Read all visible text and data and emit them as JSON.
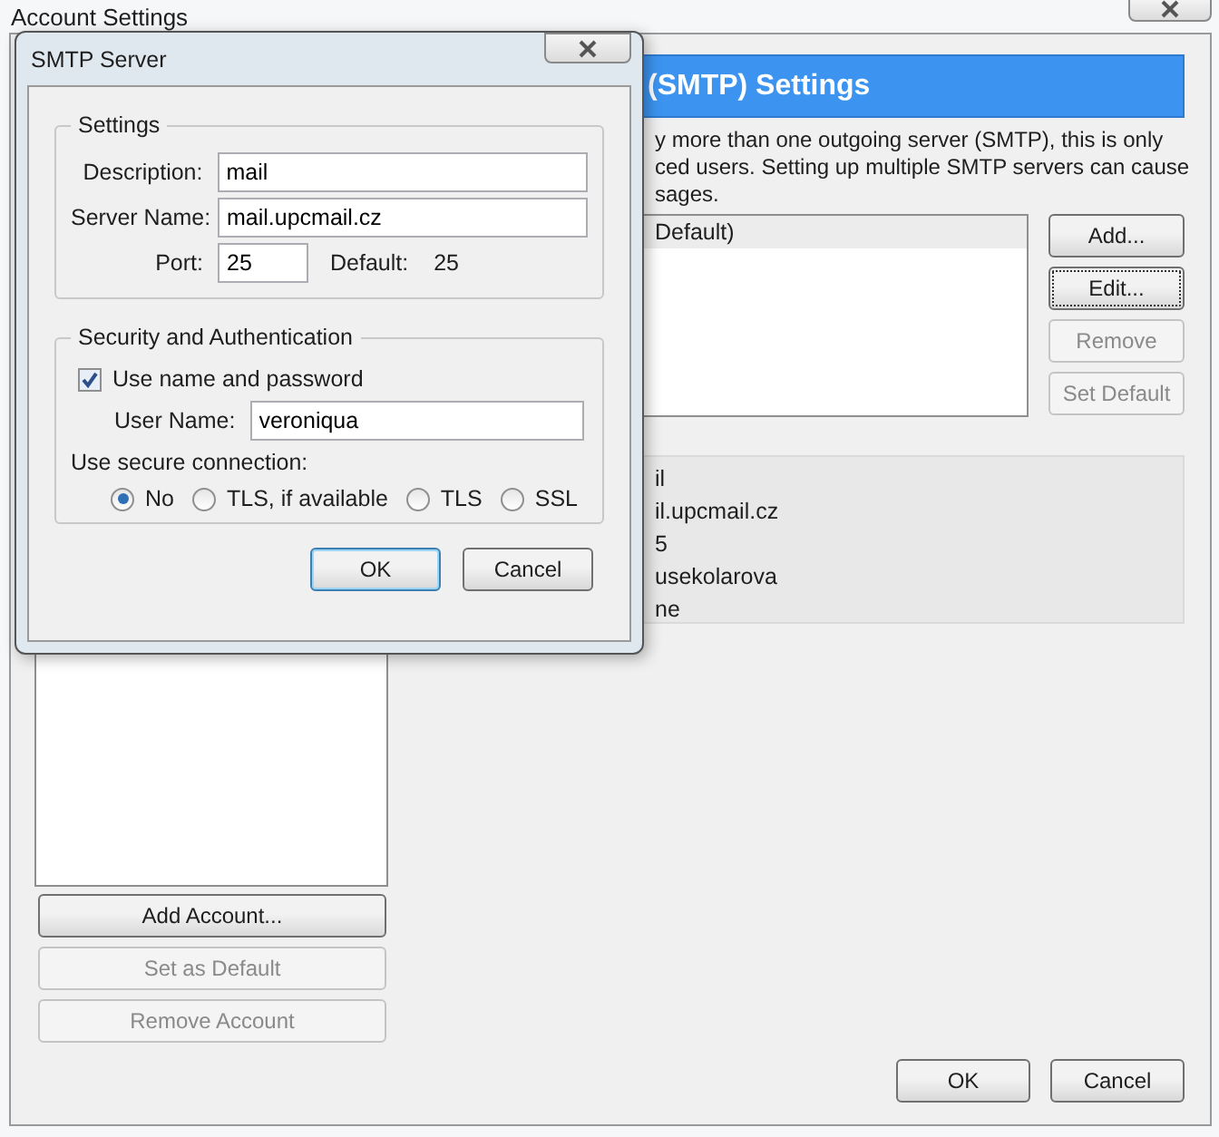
{
  "window": {
    "title": "Account Settings"
  },
  "accounts_panel": {
    "buttons": [
      {
        "label": "Add Account...",
        "disabled": false
      },
      {
        "label": "Set as Default",
        "disabled": true
      },
      {
        "label": "Remove Account",
        "disabled": true
      }
    ]
  },
  "smtp_panel": {
    "heading": "(SMTP) Settings",
    "description": [
      "y more than one outgoing server (SMTP), this is only",
      "ced users. Setting up multiple SMTP servers can cause",
      "sages."
    ],
    "servers": [
      {
        "label": "Default)",
        "selected": true
      }
    ],
    "buttons": [
      {
        "label": "Add...",
        "disabled": false,
        "focused": false
      },
      {
        "label": "Edit...",
        "disabled": false,
        "focused": true
      },
      {
        "label": "Remove",
        "disabled": true,
        "focused": false
      },
      {
        "label": "Set Default",
        "disabled": true,
        "focused": false
      }
    ],
    "details": [
      "il",
      "il.upcmail.cz",
      "5",
      "usekolarova",
      "ne"
    ]
  },
  "footer_buttons": [
    "OK",
    "Cancel"
  ],
  "dialog": {
    "title": "SMTP Server",
    "settings": {
      "legend": "Settings",
      "description_label": "Description:",
      "description": "mail",
      "server_name_label": "Server Name:",
      "server_name": "mail.upcmail.cz",
      "port_label": "Port:",
      "port": "25",
      "default_label": "Default:",
      "default_port": "25"
    },
    "security": {
      "legend": "Security and Authentication",
      "use_password": {
        "label": "Use name and password",
        "checked": true
      },
      "user_name_label": "User Name:",
      "user_name": "veroniqua",
      "secure_label": "Use secure connection:",
      "options": [
        {
          "label": "No",
          "selected": true
        },
        {
          "label": "TLS, if available",
          "selected": false
        },
        {
          "label": "TLS",
          "selected": false
        },
        {
          "label": "SSL",
          "selected": false
        }
      ]
    },
    "buttons": [
      {
        "label": "OK",
        "focused": true
      },
      {
        "label": "Cancel",
        "focused": false
      }
    ]
  }
}
